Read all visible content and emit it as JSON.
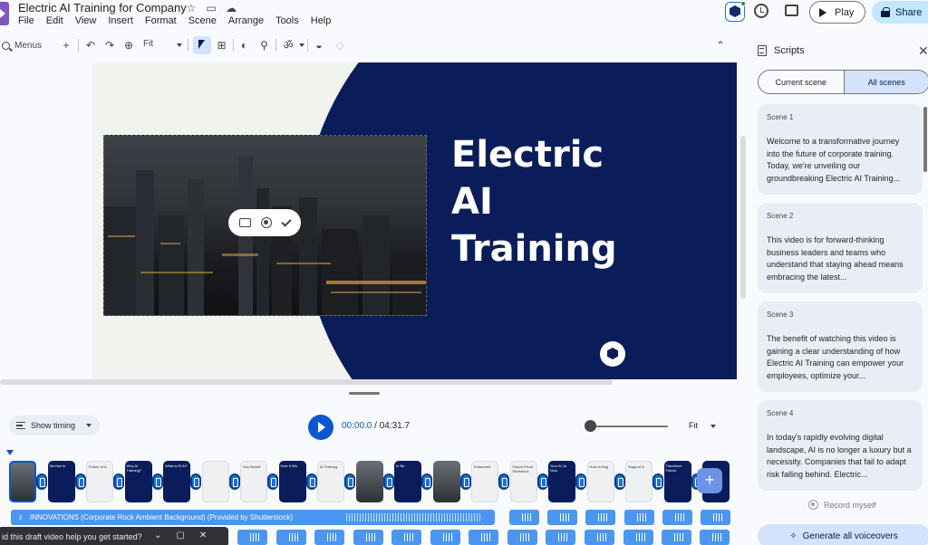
{
  "header": {
    "title": "Electric AI Training for Company",
    "menu": [
      "File",
      "Edit",
      "View",
      "Insert",
      "Format",
      "Scene",
      "Arrange",
      "Tools",
      "Help"
    ],
    "play_label": "Play",
    "share_label": "Share"
  },
  "toolbar": {
    "menus_label": "Menus",
    "zoom_label": "Fit"
  },
  "slide": {
    "title_lines": [
      "Electric",
      "AI",
      "Training"
    ]
  },
  "timeline": {
    "show_timing_label": "Show timing",
    "current_time": "00:00.0",
    "total_time": "/ 04:31.7",
    "zoom_label": "Fit",
    "audio_track_label": "INNOVATIONS (Corporate Rock Ambient Background) (Provided by Shutterstock)",
    "scenes": [
      {
        "style": "photo-s",
        "text": ""
      },
      {
        "style": "navy",
        "text": "Service In"
      },
      {
        "style": "light",
        "text": "Future of A"
      },
      {
        "style": "navy",
        "text": "Why AI Training?"
      },
      {
        "style": "navy",
        "text": "What is El AI?"
      },
      {
        "style": "light",
        "text": ""
      },
      {
        "style": "light",
        "text": "Key Benefi"
      },
      {
        "style": "navy",
        "text": "How It Wo"
      },
      {
        "style": "light",
        "text": "AI Training"
      },
      {
        "style": "photo-s",
        "text": ""
      },
      {
        "style": "navy",
        "text": "In Bu"
      },
      {
        "style": "photo-s",
        "text": ""
      },
      {
        "style": "light",
        "text": "Enhanced"
      },
      {
        "style": "light",
        "text": "Future-Proof Workforce"
      },
      {
        "style": "navy",
        "text": "Your AI Jo Now"
      },
      {
        "style": "light",
        "text": "How to Beg"
      },
      {
        "style": "light",
        "text": "Support &"
      },
      {
        "style": "navy",
        "text": "Transform Future"
      },
      {
        "style": "navy",
        "text": ""
      }
    ]
  },
  "toast": {
    "text": "id this draft video help you get started?"
  },
  "scripts": {
    "title": "Scripts",
    "tab_current": "Current scene",
    "tab_all": "All scenes",
    "cards": [
      {
        "label": "Scene 1",
        "text": "Welcome to a transformative journey into the future of corporate training. Today, we're unveiling our groundbreaking Electric AI Training..."
      },
      {
        "label": "Scene 2",
        "text": "This video is for forward-thinking business leaders and teams who understand that staying ahead means embracing the latest..."
      },
      {
        "label": "Scene 3",
        "text": "The benefit of watching this video is gaining a clear understanding of how Electric AI Training can empower your employees, optimize your..."
      },
      {
        "label": "Scene 4",
        "text": "In today's rapidly evolving digital landscape, AI is no longer a luxury but a necessity. Companies that fail to adapt risk falling behind. Electric..."
      }
    ],
    "record_label": "Record myself",
    "generate_label": "Generate all voiceovers"
  }
}
